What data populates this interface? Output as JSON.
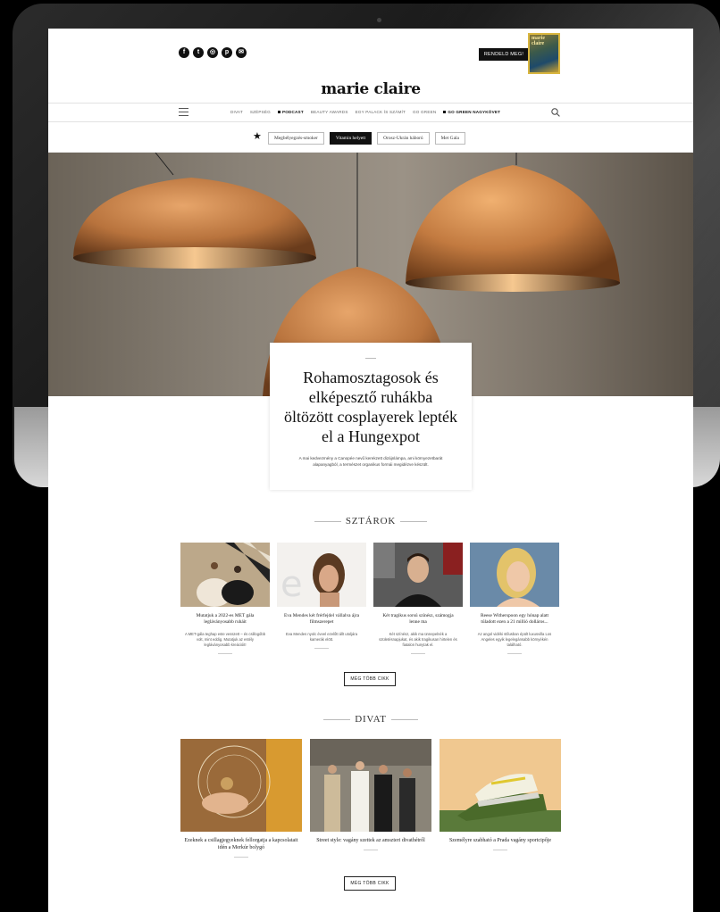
{
  "header": {
    "social_icons": [
      "facebook-icon",
      "twitter-icon",
      "instagram-icon",
      "pinterest-icon",
      "email-icon"
    ],
    "order_button": "RENDELD MEG!",
    "magazine_title": "marie claire",
    "logo": "marie claire"
  },
  "nav": {
    "items": [
      {
        "label": "DIVAT",
        "strong": false
      },
      {
        "label": "SZÉPSÉG",
        "strong": false
      },
      {
        "label": "PODCAST",
        "strong": true
      },
      {
        "label": "BEAUTY AWARDS",
        "strong": false
      },
      {
        "label": "EGY PALACK ÍS SZÁMÍT",
        "strong": false
      },
      {
        "label": "GO GREEN",
        "strong": false
      },
      {
        "label": "GO GREEN NAGYKÖVET",
        "strong": true
      }
    ]
  },
  "tags": [
    {
      "label": "Megbélyegzés-smoker",
      "active": false
    },
    {
      "label": "Vitamin helyett",
      "active": true
    },
    {
      "label": "Orosz-Ukrán háború",
      "active": false
    },
    {
      "label": "Met Gala",
      "active": false
    }
  ],
  "hero": {
    "title": "Rohamosztagosok és elképesztő ruhákba öltözött cosplayerek lepték el a Hungexpot",
    "lead": "A mai kedvezmény a Canopée nevű kerekzett dizájnlámpa, ami környezetbarát alapanyagból, a természet organikus formái megidézve készült."
  },
  "sections": {
    "stars": {
      "heading": "SZTÁROK",
      "cards": [
        {
          "title": "Mutatjuk a 2022-es MET gála legláványosabb ruháit",
          "excerpt": "A MET-gála teghap este vesszett – és csillogóbb volt, mint eddig. Mutatjuk az estély legláványosabb kreációit!"
        },
        {
          "title": "Eva Mendes két frérfejdel vállalva ájra filmszerepet",
          "excerpt": "Eva Mendes nyolc évvel ezelőtt állt utoljára kamerák elött."
        },
        {
          "title": "Két tragikus sorsú színész, számogja lenne ma",
          "excerpt": "Két színész, akik ma ünnepelnék a születésnapjukat, és akik tragikusan hirtelen és fiatalon hunytak el."
        },
        {
          "title": "Reese Witherspoon egy hónap alatt túladott ezen a 21 millió dolláros...",
          "excerpt": "Az angol vidéki stílusban épült luxusvilla Los Angeles egyik legelegánsabb környékén található."
        }
      ],
      "more_button": "MÉG TÖBB CIKK"
    },
    "fashion": {
      "heading": "DIVAT",
      "cards": [
        {
          "title": "Ezeknek a csillagjegyeknek fellorgatja a kapcsolatait idén a Merkúr bolygó"
        },
        {
          "title": "Street style: vagány szettek az amszteri divathétről"
        },
        {
          "title": "Személyre szabható a Prada vagány sportcipője"
        }
      ],
      "more_button": "MÉG TÖBB CIKK"
    }
  }
}
